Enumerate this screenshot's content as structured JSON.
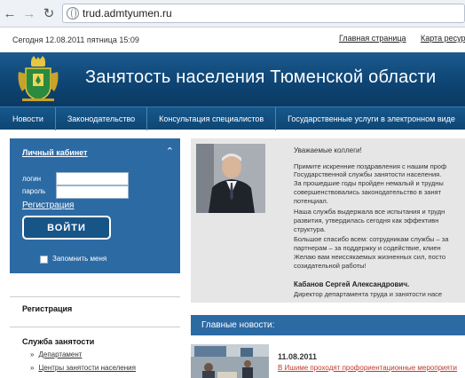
{
  "browser": {
    "url": "trud.admtyumen.ru",
    "back_icon": "arrow-left",
    "forward_icon": "arrow-right",
    "reload_icon": "reload"
  },
  "top": {
    "date_text": "Сегодня 12.08.2011 пятница 15:09",
    "home_link": "Главная страница",
    "sitemap_link": "Карта ресур"
  },
  "header": {
    "title": "Занятость населения Тюменской области",
    "color": "#0e4574"
  },
  "menu": {
    "items": [
      {
        "label": "Новости"
      },
      {
        "label": "Законодательство"
      },
      {
        "label": "Консультация специалистов"
      },
      {
        "label": "Государственные услуги в электронном виде"
      }
    ]
  },
  "login": {
    "title": "Личный кабинет",
    "login_label": "логин",
    "password_label": "пароль",
    "register_link": "Регистрация",
    "button": "ВОЙТИ",
    "remember": "Запомнить меня",
    "color": "#2c6aa4"
  },
  "left": {
    "registration_heading": "Регистрация",
    "service_heading": "Служба занятости",
    "service_items": [
      {
        "label": "Департамент"
      },
      {
        "label": "Центры занятости населения"
      }
    ]
  },
  "greeting": {
    "salutation": "Уважаемые коллеги!",
    "lines": [
      "Примите искренние поздравления с нашим проф",
      "Государственной службы занятости населения.",
      "За прошедшие годы пройден немалый и трудны",
      "совершенствовались законодательство в занят",
      "потенциал.",
      "Наша служба выдержала все испытания и трудн",
      "развития, утвердилась сегодня как эффективн",
      "структура.",
      "Большое спасибо всем: сотрудникам службы – за",
      "партнерам – за поддержку и содействие, клиен",
      "Желаю вам неиссякаемых жизненных сил, посто",
      "созидательной работы!"
    ],
    "signature": "Кабанов Сергей Александрович.",
    "position": "Директор департамента труда и занятости насе"
  },
  "news": {
    "heading": "Главные новости:",
    "items": [
      {
        "date": "11.08.2011",
        "title": "В Ишиме проходят профориентационные мероприяти"
      }
    ]
  }
}
